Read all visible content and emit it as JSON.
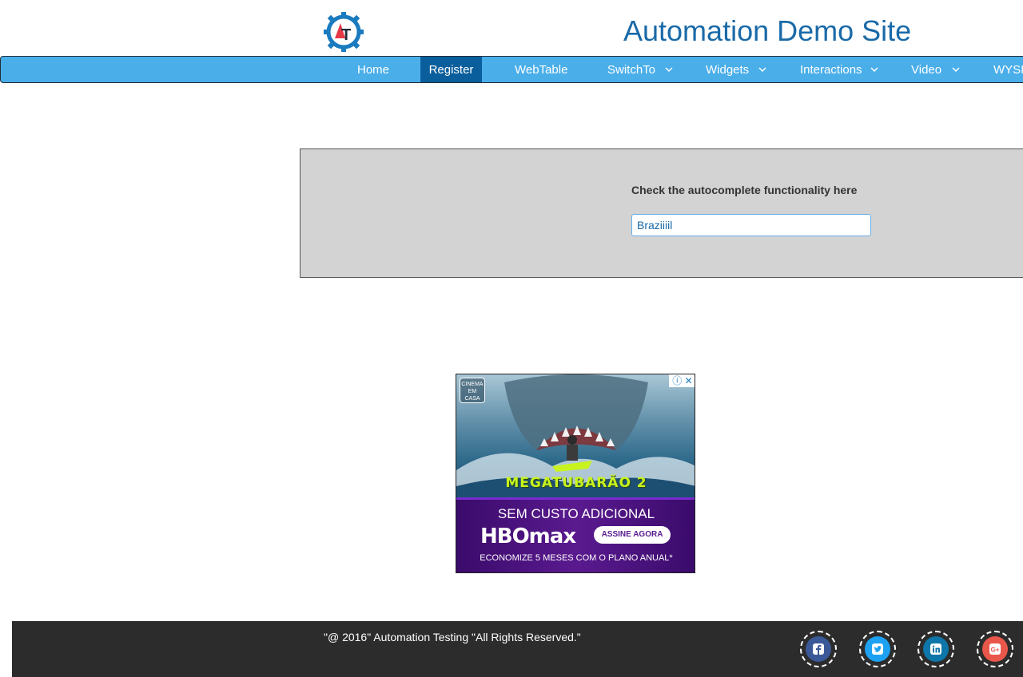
{
  "header": {
    "title": "Automation Demo Site",
    "logo_icon": "gear-logo-icon",
    "logo_text": "AT"
  },
  "nav": {
    "items": [
      {
        "label": "Home",
        "dropdown": false
      },
      {
        "label": "Register",
        "dropdown": false,
        "active": true
      },
      {
        "label": "WebTable",
        "dropdown": false
      },
      {
        "label": "SwitchTo",
        "dropdown": true
      },
      {
        "label": "Widgets",
        "dropdown": true
      },
      {
        "label": "Interactions",
        "dropdown": true
      },
      {
        "label": "Video",
        "dropdown": true
      },
      {
        "label": "WYSI",
        "dropdown": false
      }
    ]
  },
  "autocomplete": {
    "label": "Check the autocomplete functionality here",
    "value": "Braziiiil"
  },
  "ad": {
    "badge": "CINEMA EM CASA",
    "movie": "MEGATUBARÃO 2",
    "headline": "SEM CUSTO ADICIONAL",
    "brand": "HBOmax",
    "cta": "ASSINE AGORA",
    "footnote": "ECONOMIZE 5 MESES COM O PLANO ANUAL*"
  },
  "footer": {
    "copyright": "\"@ 2016\" Automation Testing \"All Rights Reserved.\"",
    "social": [
      {
        "icon": "facebook-icon",
        "color": "#3b5998"
      },
      {
        "icon": "twitter-icon",
        "color": "#1da1f2"
      },
      {
        "icon": "linkedin-icon",
        "color": "#0e76a8"
      },
      {
        "icon": "google-plus-icon",
        "color": "#e8574a"
      }
    ]
  },
  "colors": {
    "accent": "#4aaee9",
    "nav_active": "#0b5e9c",
    "title": "#1a6aa8",
    "footer_bg": "#2c2c2c"
  }
}
